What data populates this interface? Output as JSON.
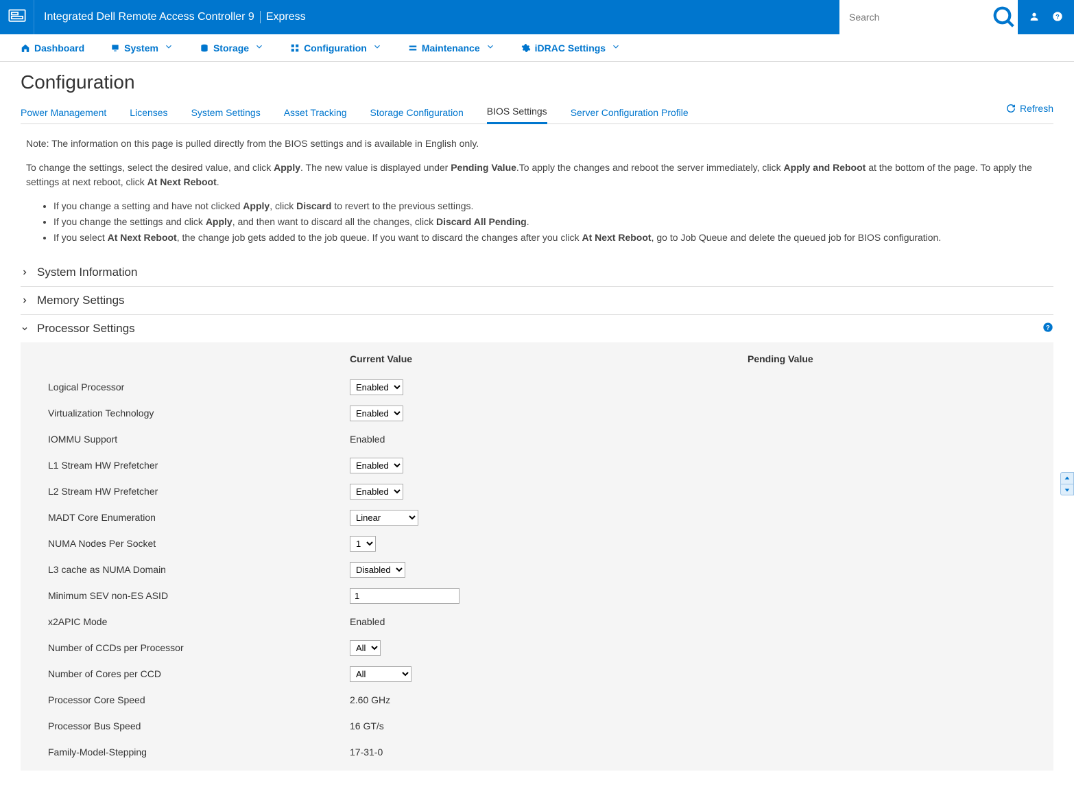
{
  "brand": {
    "line1": "Integrated Dell Remote Access Controller 9",
    "line2": "Express"
  },
  "search": {
    "placeholder": "Search"
  },
  "nav": {
    "dashboard": "Dashboard",
    "system": "System",
    "storage": "Storage",
    "configuration": "Configuration",
    "maintenance": "Maintenance",
    "idrac": "iDRAC Settings"
  },
  "page_title": "Configuration",
  "tabs": {
    "power": "Power Management",
    "licenses": "Licenses",
    "system_settings": "System Settings",
    "asset": "Asset Tracking",
    "storage_conf": "Storage Configuration",
    "bios": "BIOS Settings",
    "scp": "Server Configuration Profile",
    "refresh": "Refresh"
  },
  "notes": {
    "line1": "Note: The information on this page is pulled directly from the BIOS settings and is available in English only.",
    "p2_a": "To change the settings, select the desired value, and click ",
    "apply": "Apply",
    "p2_b": ". The new value is displayed under ",
    "pending": "Pending Value",
    "p2_c": ".To apply the changes and reboot the server immediately, click ",
    "apply_reboot": "Apply and Reboot",
    "p2_d": " at the bottom of the page. To apply the settings at next reboot, click ",
    "at_next": "At Next Reboot",
    "p2_e": ".",
    "li1_a": "If you change a setting and have not clicked ",
    "li1_b": ", click ",
    "discard": "Discard",
    "li1_c": " to revert to the previous settings.",
    "li2_a": "If you change the settings and click ",
    "li2_b": ", and then want to discard all the changes, click ",
    "discard_all": "Discard All Pending",
    "li2_c": ".",
    "li3_a": "If you select ",
    "li3_b": ", the change job gets added to the job queue. If you want to discard the changes after you click ",
    "li3_c": ", go to Job Queue and delete the queued job for BIOS configuration."
  },
  "sections": {
    "sysinfo": "System Information",
    "memory": "Memory Settings",
    "processor": "Processor Settings"
  },
  "cols": {
    "current": "Current Value",
    "pending": "Pending Value"
  },
  "proc": {
    "logical": {
      "label": "Logical Processor",
      "value": "Enabled"
    },
    "virt": {
      "label": "Virtualization Technology",
      "value": "Enabled"
    },
    "iommu": {
      "label": "IOMMU Support",
      "value": "Enabled"
    },
    "l1": {
      "label": "L1 Stream HW Prefetcher",
      "value": "Enabled"
    },
    "l2": {
      "label": "L2 Stream HW Prefetcher",
      "value": "Enabled"
    },
    "madt": {
      "label": "MADT Core Enumeration",
      "value": "Linear"
    },
    "numa": {
      "label": "NUMA Nodes Per Socket",
      "value": "1"
    },
    "l3numa": {
      "label": "L3 cache as NUMA Domain",
      "value": "Disabled"
    },
    "sev": {
      "label": "Minimum SEV non-ES ASID",
      "value": "1"
    },
    "x2apic": {
      "label": "x2APIC Mode",
      "value": "Enabled"
    },
    "ccds": {
      "label": "Number of CCDs per Processor",
      "value": "All"
    },
    "cores": {
      "label": "Number of Cores per CCD",
      "value": "All"
    },
    "corespeed": {
      "label": "Processor Core Speed",
      "value": "2.60 GHz"
    },
    "busspeed": {
      "label": "Processor Bus Speed",
      "value": "16 GT/s"
    },
    "fms": {
      "label": "Family-Model-Stepping",
      "value": "17-31-0"
    }
  }
}
